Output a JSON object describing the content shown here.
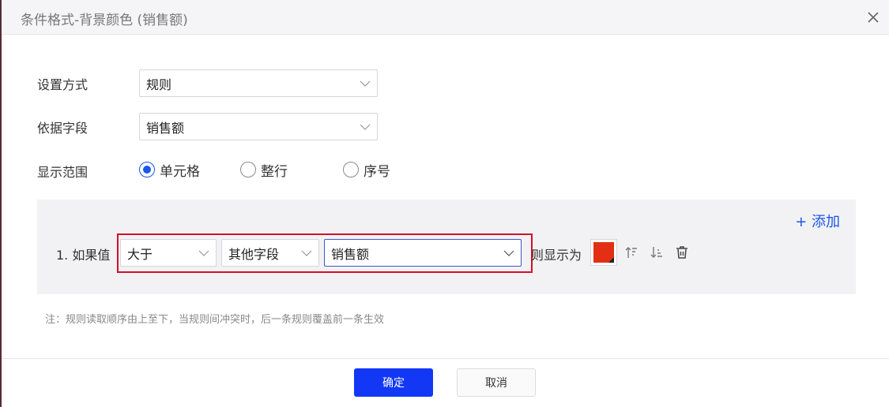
{
  "dialog": {
    "title": "条件格式-背景颜色 (销售额)"
  },
  "form": {
    "mode_label": "设置方式",
    "mode_value": "规则",
    "field_label": "依据字段",
    "field_value": "销售额",
    "range_label": "显示范围",
    "range_options": [
      {
        "label": "单元格",
        "selected": true
      },
      {
        "label": "整行",
        "selected": false
      },
      {
        "label": "序号",
        "selected": false
      }
    ]
  },
  "rules": {
    "add_label": "+ 添加",
    "items": [
      {
        "prefix": "1. 如果值",
        "operator": "大于",
        "compare_type": "其他字段",
        "compare_field": "销售额",
        "suffix": "则显示为",
        "color": "#e32f14"
      }
    ]
  },
  "icons": [
    "close-icon",
    "chevron-down-icon",
    "move-up-icon",
    "move-down-icon",
    "delete-icon"
  ],
  "note": "注：规则读取顺序由上至下，当规则间冲突时，后一条规则覆盖前一条生效",
  "footer": {
    "confirm_label": "确定",
    "cancel_label": "取消"
  },
  "colors": {
    "accent": "#1a56e8",
    "primary_button": "#1238f5",
    "highlight_border": "#d2102a"
  }
}
